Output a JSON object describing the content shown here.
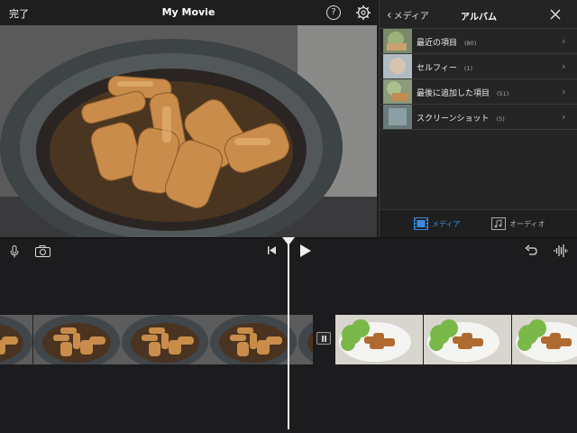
{
  "topbar": {
    "done_label": "完了",
    "title": "My Movie",
    "help_glyph": "?"
  },
  "panel": {
    "back_label": "メディア",
    "title": "アルバム",
    "albums": [
      {
        "label": "最近の項目",
        "count": "(80)"
      },
      {
        "label": "セルフィー",
        "count": "(1)"
      },
      {
        "label": "最後に追加した項目",
        "count": "(51)"
      },
      {
        "label": "スクリーンショット",
        "count": "(5)"
      }
    ],
    "tabs": {
      "media": "メディア",
      "audio": "オーディオ"
    }
  },
  "colors": {
    "accent": "#3a8be0",
    "background": "#1c1c1e",
    "panel": "#252525"
  }
}
